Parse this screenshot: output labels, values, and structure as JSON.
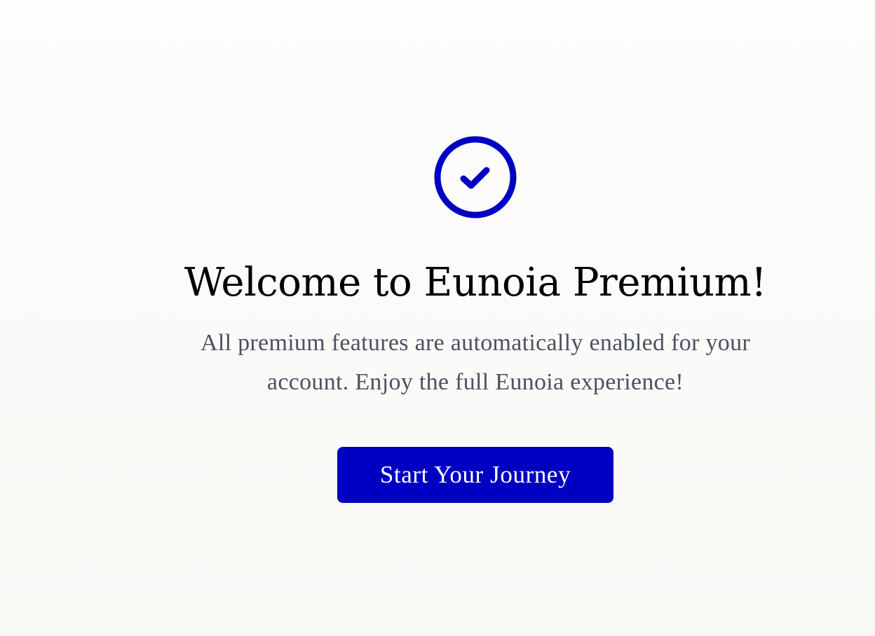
{
  "welcome": {
    "title": "Welcome to Eunoia Premium!",
    "message": "All premium features are automatically enabled for your account. Enjoy the full Eunoia experience!",
    "cta_label": "Start Your Journey",
    "icon": "check-circle-icon"
  },
  "colors": {
    "accent": "#0000c2",
    "text_primary": "#000000",
    "text_secondary": "#4b5163",
    "background": "#fbfaf8"
  }
}
